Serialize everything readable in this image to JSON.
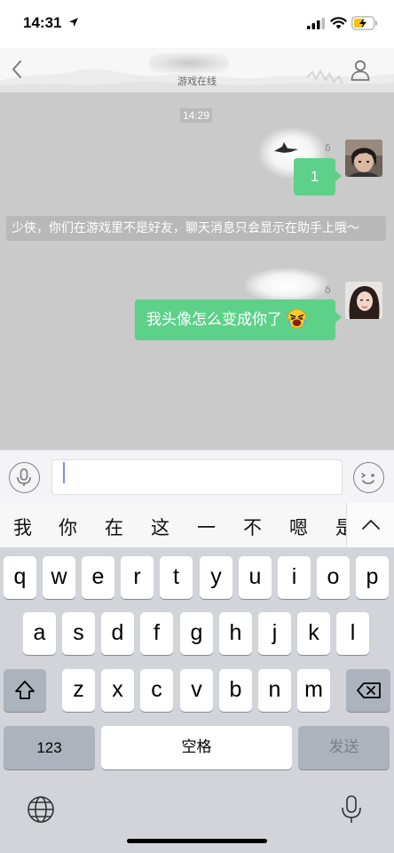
{
  "status_bar": {
    "time": "14:31"
  },
  "header": {
    "subtitle": "游戏在线"
  },
  "chat": {
    "timestamp": "14:29",
    "messages": [
      {
        "side": "right",
        "text": "1"
      },
      {
        "side": "right",
        "text": "我头像怎么变成你了"
      }
    ],
    "status_marks": [
      "δ",
      "δ"
    ],
    "system_notice": "少侠，你们在游戏里不是好友，聊天消息只会显示在助手上哦～"
  },
  "candidates": [
    "我",
    "你",
    "在",
    "这",
    "一",
    "不",
    "嗯",
    "是"
  ],
  "keyboard": {
    "row1": [
      "q",
      "w",
      "e",
      "r",
      "t",
      "y",
      "u",
      "i",
      "o",
      "p"
    ],
    "row2": [
      "a",
      "s",
      "d",
      "f",
      "g",
      "h",
      "j",
      "k",
      "l"
    ],
    "row3": [
      "z",
      "x",
      "c",
      "v",
      "b",
      "n",
      "m"
    ],
    "numbers_label": "123",
    "space_label": "空格",
    "send_label": "发送"
  },
  "colors": {
    "bubble": "#5dd18a",
    "chat_bg": "#cacaca",
    "keyboard_bg": "#d2d4da"
  }
}
